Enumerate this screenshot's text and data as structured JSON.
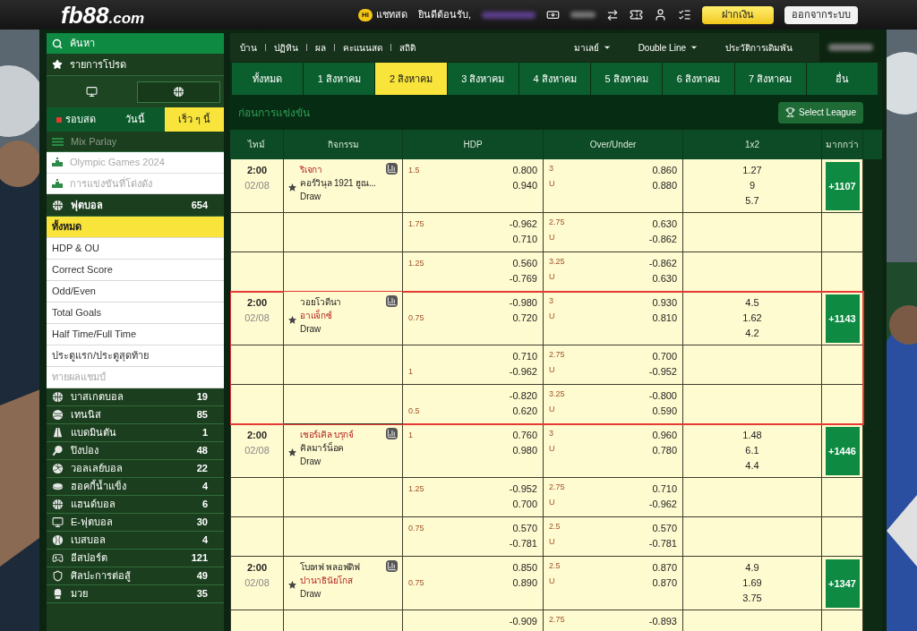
{
  "header": {
    "logo": {
      "main": "fb88",
      "suffix": ".com"
    },
    "chat_badge": "Hi",
    "chat": "แชทสด",
    "greeting": "ยินดีต้อนรับ,",
    "deposit": "ฝากเงิน",
    "logout": "ออกจากระบบ"
  },
  "sidebar": {
    "search": "ค้นหา",
    "favorites": "รายการโปรด",
    "view_modes": [
      {
        "selected": false
      },
      {
        "selected": true
      }
    ],
    "period_tabs": [
      {
        "label": "รอบสด",
        "live": true,
        "selected": false
      },
      {
        "label": "วันนี้",
        "live": false,
        "selected": false
      },
      {
        "label": "เร็ว ๆ นี้",
        "live": false,
        "selected": true
      }
    ],
    "mix_parlay": {
      "label": "Mix Parlay",
      "disabled": true
    },
    "featured": [
      {
        "label": "Olympic Games 2024",
        "disabled": true
      },
      {
        "label": "การแข่งขันที่โด่งดัง",
        "disabled": true
      }
    ],
    "sport": {
      "name": "ฟุตบอล",
      "count": "654"
    },
    "markets": [
      {
        "label": "ทั้งหมด",
        "selected": true,
        "disabled": false
      },
      {
        "label": "HDP & OU",
        "selected": false,
        "disabled": false
      },
      {
        "label": "Correct Score",
        "selected": false,
        "disabled": false
      },
      {
        "label": "Odd/Even",
        "selected": false,
        "disabled": false
      },
      {
        "label": "Total Goals",
        "selected": false,
        "disabled": false
      },
      {
        "label": "Half Time/Full Time",
        "selected": false,
        "disabled": false
      },
      {
        "label": "ประตูแรก/ประตูสุดท้าย",
        "selected": false,
        "disabled": false
      },
      {
        "label": "ทายผลแชมป์",
        "selected": false,
        "disabled": true
      }
    ],
    "sports": [
      {
        "name": "บาสเกตบอล",
        "count": "19"
      },
      {
        "name": "เทนนิส",
        "count": "85"
      },
      {
        "name": "แบดมินตัน",
        "count": "1"
      },
      {
        "name": "ปิงปอง",
        "count": "48"
      },
      {
        "name": "วอลเลย์บอล",
        "count": "22"
      },
      {
        "name": "ฮอคกี้น้ำแข็ง",
        "count": "4"
      },
      {
        "name": "แฮนด์บอล",
        "count": "6"
      },
      {
        "name": "E-ฟุตบอล",
        "count": "30"
      },
      {
        "name": "เบสบอล",
        "count": "4"
      },
      {
        "name": "อีสปอร์ต",
        "count": "121"
      },
      {
        "name": "ศิลปะการต่อสู้",
        "count": "49"
      },
      {
        "name": "มวย",
        "count": "35"
      }
    ]
  },
  "topnav": {
    "links": [
      "บ้าน",
      "ปฏิทิน",
      "ผล",
      "คะแนนสด",
      "สถิติ"
    ],
    "dropdowns": [
      "มาเลย์",
      "Double Line"
    ],
    "history": "ประวัติการเดิมพัน"
  },
  "date_tabs": [
    {
      "label": "ทั้งหมด",
      "selected": false
    },
    {
      "label": "1 สิงหาคม",
      "selected": false
    },
    {
      "label": "2 สิงหาคม",
      "selected": true
    },
    {
      "label": "3 สิงหาคม",
      "selected": false
    },
    {
      "label": "4 สิงหาคม",
      "selected": false
    },
    {
      "label": "5 สิงหาคม",
      "selected": false
    },
    {
      "label": "6 สิงหาคม",
      "selected": false
    },
    {
      "label": "7 สิงหาคม",
      "selected": false
    },
    {
      "label": "อื่น",
      "selected": false
    }
  ],
  "section": {
    "title": "ก่อนการแข่งขัน",
    "select_league": "Select League"
  },
  "table": {
    "columns": [
      "ไทม์",
      "กิจกรรม",
      "HDP",
      "Over/Under",
      "1x2",
      "มากกว่า"
    ],
    "matches": [
      {
        "time": "2:00",
        "date": "02/08",
        "teams": [
          {
            "name": "ริเจกา",
            "favored": true
          },
          {
            "name": "คอร์วินุล 1921 ฮูเน...",
            "favored": false
          }
        ],
        "draw": "Draw",
        "odds_1x2": [
          "1.27",
          "9",
          "5.7"
        ],
        "more": "+1107",
        "highlighted": false,
        "lines": [
          {
            "hdp": "1.5",
            "away_favored": false,
            "hdp_odds": [
              "0.800",
              "0.940"
            ],
            "ou": "3",
            "under_label": "U",
            "ou_odds": [
              "0.860",
              "0.880"
            ]
          },
          {
            "hdp": "1.75",
            "away_favored": false,
            "hdp_odds": [
              "-0.962",
              "0.710"
            ],
            "ou": "2.75",
            "under_label": "U",
            "ou_odds": [
              "0.630",
              "-0.862"
            ]
          },
          {
            "hdp": "1.25",
            "away_favored": false,
            "hdp_odds": [
              "0.560",
              "-0.769"
            ],
            "ou": "3.25",
            "under_label": "U",
            "ou_odds": [
              "-0.862",
              "0.630"
            ]
          }
        ]
      },
      {
        "time": "2:00",
        "date": "02/08",
        "teams": [
          {
            "name": "วอยโวดีนา",
            "favored": false
          },
          {
            "name": "อาแจ็กซ์",
            "favored": true
          }
        ],
        "draw": "Draw",
        "odds_1x2": [
          "4.5",
          "1.62",
          "4.2"
        ],
        "more": "+1143",
        "highlighted": true,
        "lines": [
          {
            "hdp": "0.75",
            "away_favored": true,
            "hdp_odds": [
              "-0.980",
              "0.720"
            ],
            "ou": "3",
            "under_label": "U",
            "ou_odds": [
              "0.930",
              "0.810"
            ]
          },
          {
            "hdp": "1",
            "away_favored": true,
            "hdp_odds": [
              "0.710",
              "-0.962"
            ],
            "ou": "2.75",
            "under_label": "U",
            "ou_odds": [
              "0.700",
              "-0.952"
            ]
          },
          {
            "hdp": "0.5",
            "away_favored": true,
            "hdp_odds": [
              "-0.820",
              "0.620"
            ],
            "ou": "3.25",
            "under_label": "U",
            "ou_odds": [
              "-0.800",
              "0.590"
            ]
          }
        ]
      },
      {
        "time": "2:00",
        "date": "02/08",
        "teams": [
          {
            "name": "เชอร์เคิล บรุกจ์",
            "favored": true
          },
          {
            "name": "คิลมาร์น็อค",
            "favored": false
          }
        ],
        "draw": "Draw",
        "odds_1x2": [
          "1.48",
          "6.1",
          "4.4"
        ],
        "more": "+1446",
        "highlighted": false,
        "lines": [
          {
            "hdp": "1",
            "away_favored": false,
            "hdp_odds": [
              "0.760",
              "0.980"
            ],
            "ou": "3",
            "under_label": "U",
            "ou_odds": [
              "0.960",
              "0.780"
            ]
          },
          {
            "hdp": "1.25",
            "away_favored": false,
            "hdp_odds": [
              "-0.952",
              "0.700"
            ],
            "ou": "2.75",
            "under_label": "U",
            "ou_odds": [
              "0.710",
              "-0.962"
            ]
          },
          {
            "hdp": "0.75",
            "away_favored": false,
            "hdp_odds": [
              "0.570",
              "-0.781"
            ],
            "ou": "2.5",
            "under_label": "U",
            "ou_odds": [
              "0.570",
              "-0.781"
            ]
          }
        ]
      },
      {
        "time": "2:00",
        "date": "02/08",
        "teams": [
          {
            "name": "โบเทฟ พลอฟดิฟ",
            "favored": false
          },
          {
            "name": "ปานาธินัยโกส",
            "favored": true
          }
        ],
        "draw": "Draw",
        "odds_1x2": [
          "4.9",
          "1.69",
          "3.75"
        ],
        "more": "+1347",
        "highlighted": false,
        "lines": [
          {
            "hdp": "0.75",
            "away_favored": true,
            "hdp_odds": [
              "0.850",
              "0.890"
            ],
            "ou": "2.5",
            "under_label": "U",
            "ou_odds": [
              "0.870",
              "0.870"
            ]
          },
          {
            "hdp_odds": [
              "-0.909"
            ],
            "ou": "2.75",
            "ou_odds": [
              "-0.893"
            ]
          }
        ]
      }
    ]
  }
}
